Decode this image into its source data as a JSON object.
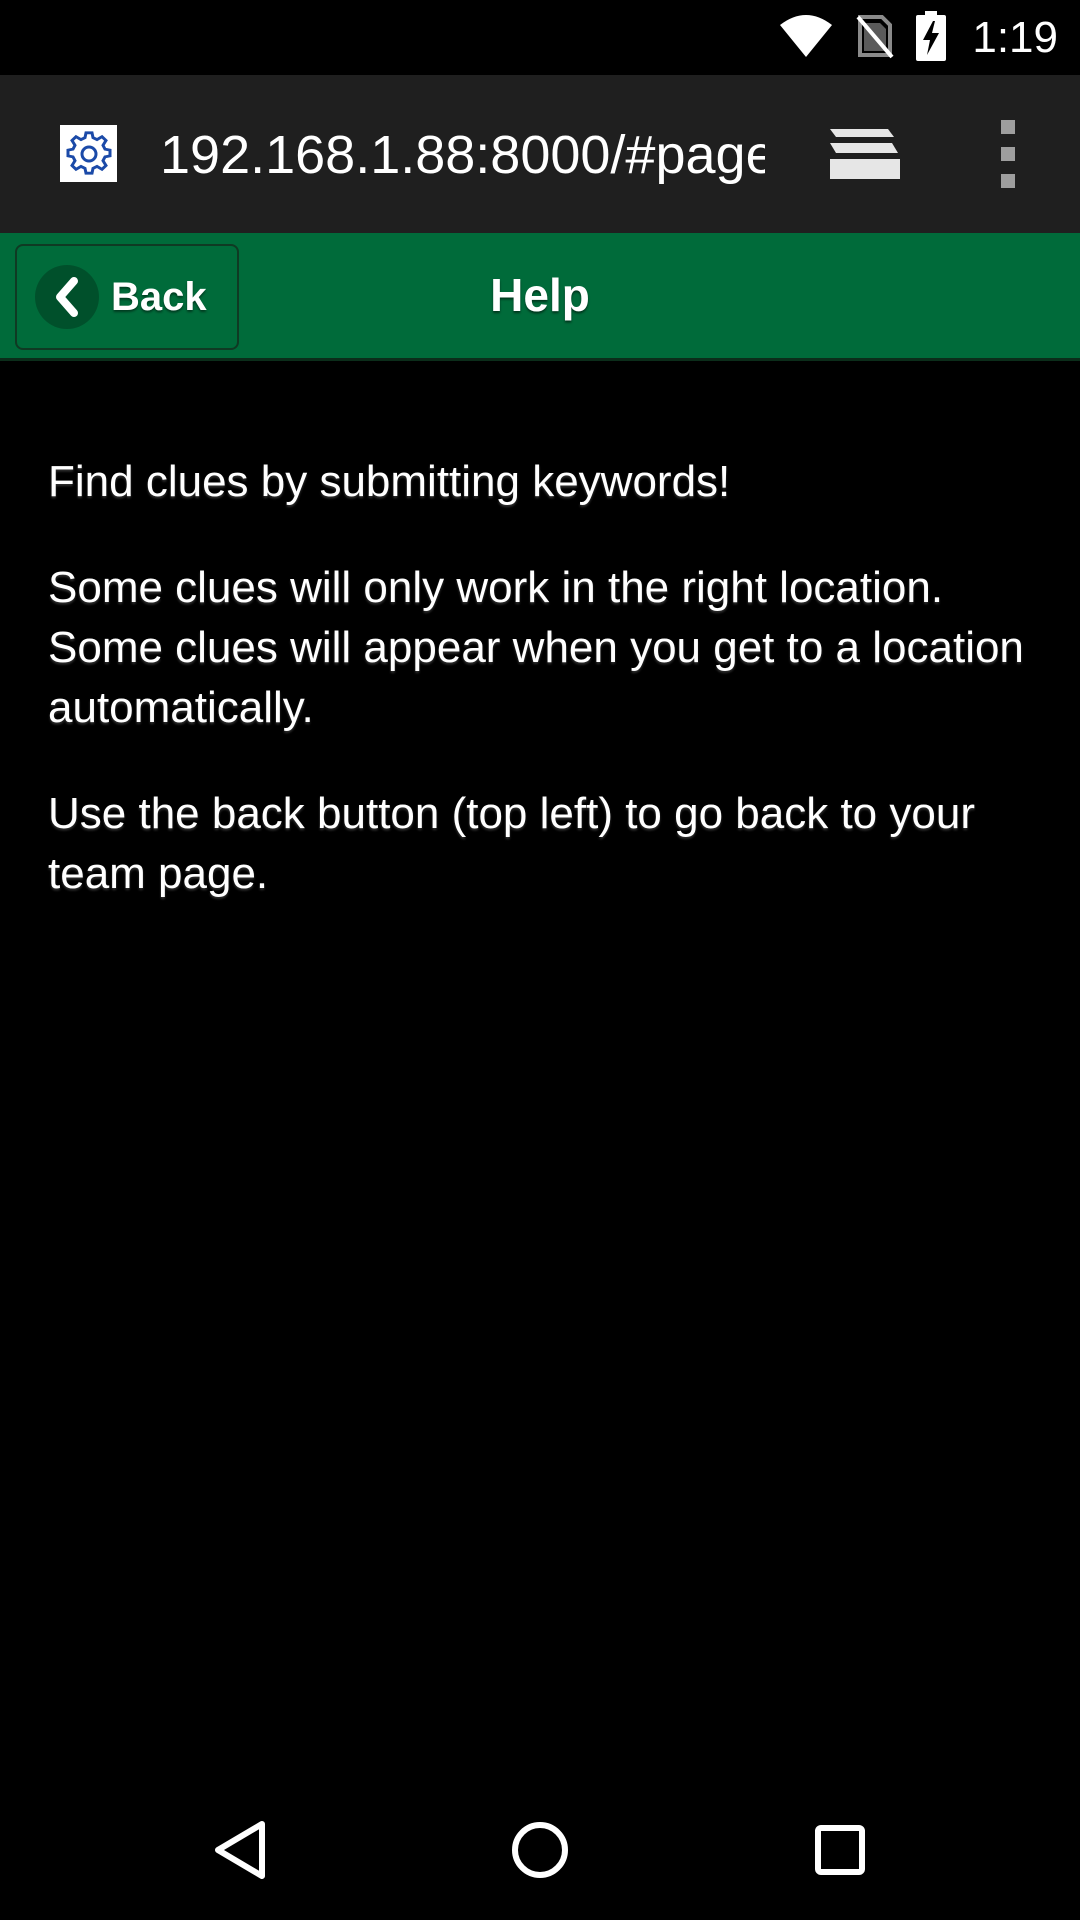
{
  "status_bar": {
    "time": "1:19",
    "icons": [
      "wifi-icon",
      "no-sim-icon",
      "battery-charging-icon"
    ]
  },
  "browser": {
    "url": "192.168.1.88:8000/#page",
    "site_icon": "gear-icon",
    "tabs_icon": "tabs-icon",
    "menu_icon": "more-vert-icon"
  },
  "header": {
    "back_label": "Back",
    "title": "Help",
    "background_color": "#006b3a"
  },
  "content": {
    "paragraphs": [
      "Find clues by submitting keywords!",
      "Some clues will only work in the right location. Some clues will appear when you get to a location automatically.",
      "Use the back button (top left) to go back to your team page."
    ]
  },
  "nav": {
    "back_icon": "nav-back-icon",
    "home_icon": "nav-home-icon",
    "recents_icon": "nav-recents-icon"
  }
}
